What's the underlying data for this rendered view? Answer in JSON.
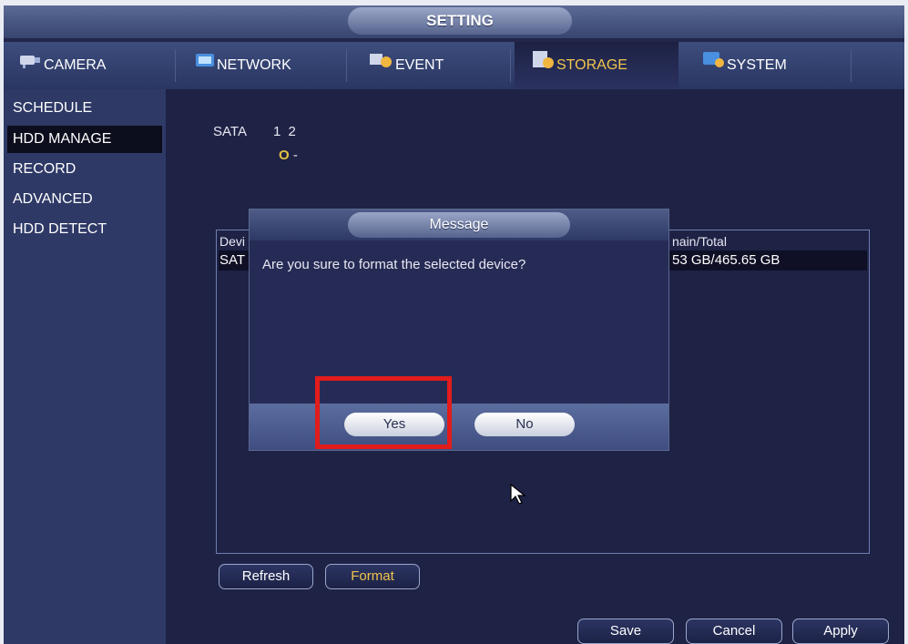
{
  "window": {
    "title": "SETTING"
  },
  "tabs": [
    {
      "label": "CAMERA",
      "icon": "camera-icon",
      "active": false
    },
    {
      "label": "NETWORK",
      "icon": "network-icon",
      "active": false
    },
    {
      "label": "EVENT",
      "icon": "event-icon",
      "active": false
    },
    {
      "label": "STORAGE",
      "icon": "storage-icon",
      "active": true
    },
    {
      "label": "SYSTEM",
      "icon": "system-icon",
      "active": false
    }
  ],
  "sidebar": {
    "items": [
      {
        "label": "SCHEDULE",
        "active": false
      },
      {
        "label": "HDD MANAGE",
        "active": true
      },
      {
        "label": "RECORD",
        "active": false
      },
      {
        "label": "ADVANCED",
        "active": false
      },
      {
        "label": "HDD DETECT",
        "active": false
      }
    ]
  },
  "sata": {
    "label": "SATA",
    "ports": "1 2",
    "status_mark": "O",
    "status_rest": "-"
  },
  "table": {
    "header_left": "Devi",
    "header_right": "nain/Total",
    "row_left": "SAT",
    "row_right": "53 GB/465.65 GB"
  },
  "actions": {
    "refresh": "Refresh",
    "format": "Format",
    "save": "Save",
    "cancel": "Cancel",
    "apply": "Apply"
  },
  "dialog": {
    "title": "Message",
    "message": "Are you sure to format the selected device?",
    "yes": "Yes",
    "no": "No"
  },
  "colors": {
    "accent_gold": "#f0c34b",
    "highlight_red": "#e21c1c",
    "panel_bg": "#1e2245"
  }
}
